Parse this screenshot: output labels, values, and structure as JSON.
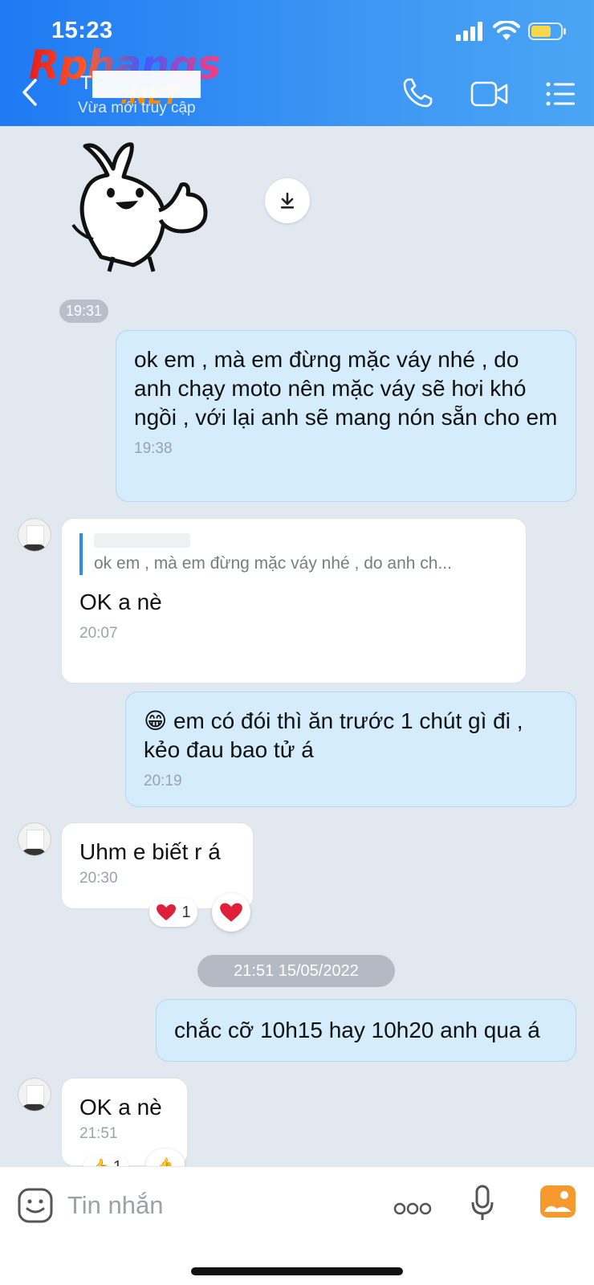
{
  "status": {
    "time": "15:23"
  },
  "header": {
    "name_initial": "T",
    "last_seen": "Vừa mới truy cập",
    "watermark": "Rphangs",
    "watermark_sub": ".NET"
  },
  "messages": {
    "t1": "19:31",
    "m1": {
      "text": "ok em , mà em đừng mặc váy nhé , do anh chạy moto nên mặc váy sẽ hơi khó ngồi , với lại anh sẽ mang nón sẵn cho em",
      "time": "19:38"
    },
    "m2": {
      "quote": "ok em , mà em đừng mặc váy nhé , do anh ch...",
      "text": "OK a nè",
      "time": "20:07"
    },
    "m3": {
      "emoji": "😁",
      "text": "em có đói thì ăn trước 1 chút gì đi , kẻo đau bao tử á",
      "time": "20:19"
    },
    "m4": {
      "text": "Uhm e biết r á",
      "time": "20:30",
      "reaction_count": "1"
    },
    "date_divider": "21:51 15/05/2022",
    "m5": {
      "text": "chắc cỡ 10h15 hay 10h20 anh qua á"
    },
    "m6": {
      "text": "OK a nè",
      "time": "21:51",
      "reaction_count": "1"
    }
  },
  "input": {
    "placeholder": "Tin nhắn"
  },
  "colors": {
    "header": "#1f7af3",
    "sent_bubble": "#d4ecfb",
    "heart": "#e0203a"
  }
}
